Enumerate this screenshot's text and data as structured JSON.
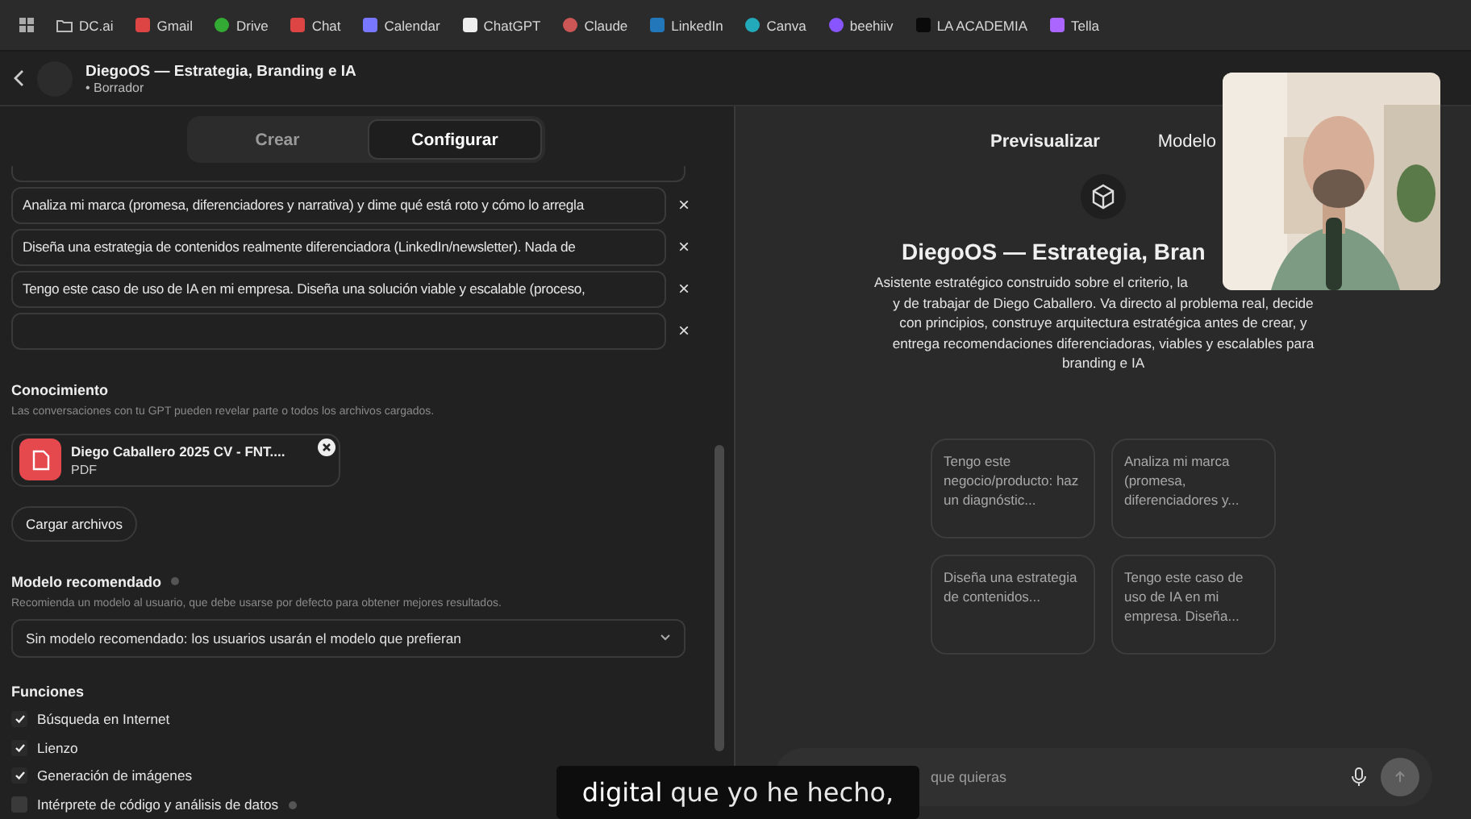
{
  "bookmarks": [
    {
      "label": "DC.ai",
      "kind": "folder"
    },
    {
      "label": "Gmail",
      "kind": "mail"
    },
    {
      "label": "Drive",
      "kind": "drive"
    },
    {
      "label": "Chat",
      "kind": "mail"
    },
    {
      "label": "Calendar",
      "kind": "calendar"
    },
    {
      "label": "ChatGPT",
      "kind": "chatgpt"
    },
    {
      "label": "Claude",
      "kind": "dot"
    },
    {
      "label": "LinkedIn",
      "kind": "linkedin"
    },
    {
      "label": "Canva",
      "kind": "canva"
    },
    {
      "label": "beehiiv",
      "kind": "bee"
    },
    {
      "label": "LA ACADEMIA",
      "kind": "academia"
    },
    {
      "label": "Tella",
      "kind": "tella"
    }
  ],
  "header": {
    "title": "DiegoOS — Estrategia, Branding e IA",
    "status": "• Borrador"
  },
  "editor_tabs": [
    {
      "label": "Crear",
      "selected": false
    },
    {
      "label": "Configurar",
      "selected": true
    }
  ],
  "starters": [
    {
      "value": "Analiza mi marca (promesa, diferenciadores y narrativa) y dime qué está roto y cómo lo arregla",
      "remove": "×"
    },
    {
      "value": "Diseña una estrategia de contenidos realmente diferenciadora (LinkedIn/newsletter). Nada de",
      "remove": "×"
    },
    {
      "value": "Tengo este caso de uso de IA en mi empresa. Diseña una solución viable y escalable (proceso,",
      "remove": "×"
    },
    {
      "remove": "×"
    }
  ],
  "knowledge": {
    "heading": "Conocimiento",
    "description": "Las conversaciones con tu GPT pueden revelar parte o todos los archivos cargados.",
    "file": {
      "name": "Diego Caballero 2025 CV - FNT....",
      "type": "PDF"
    },
    "upload_button": "Cargar archivos"
  },
  "recommended_model": {
    "heading": "Modelo recomendado",
    "description": "Recomienda un modelo al usuario, que debe usarse por defecto para obtener mejores resultados.",
    "select_value": "Sin modelo recomendado: los usuarios usarán el modelo que prefieran"
  },
  "functions": {
    "heading": "Funciones",
    "items": [
      {
        "label": "Búsqueda en Internet",
        "checked": true,
        "info": false
      },
      {
        "label": "Lienzo",
        "checked": true,
        "info": false
      },
      {
        "label": "Generación de imágenes",
        "checked": true,
        "info": false
      },
      {
        "label": "Intérprete de código y análisis de datos",
        "checked": false,
        "info": true
      }
    ]
  },
  "preview": {
    "tabs": [
      {
        "label": "Previsualizar",
        "selected": true
      },
      {
        "label": "Modelo",
        "selected": false
      }
    ],
    "title": "DiegoOS — Estrategia, Bran",
    "description_lines": [
      "Asistente estratégico construido sobre el criterio, la",
      "y de trabajar de Diego Caballero. Va directo al problema real, decide",
      "con principios, construye arquitectura estratégica antes de crear, y",
      "entrega recomendaciones diferenciadoras, viables y escalables para",
      "branding e IA"
    ],
    "cards": [
      "Tengo este negocio/producto: haz un diagnóstic...",
      "Analiza mi marca (promesa, diferenciadores y...",
      "Diseña una estrategia de contenidos...",
      "Tengo este caso de uso de IA en mi empresa. Diseña..."
    ],
    "composer_placeholder": "que quieras"
  },
  "caption": {
    "highlight": "digital",
    "rest": "que yo he hecho,"
  }
}
